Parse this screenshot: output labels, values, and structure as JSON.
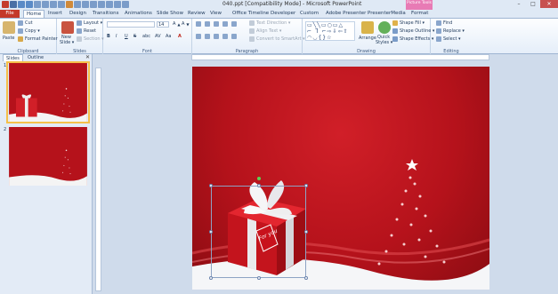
{
  "window": {
    "title": "040.ppt [Compatibility Mode] - Microsoft PowerPoint",
    "contextual_tab_group": "Picture Tools",
    "controls": [
      "–",
      "□",
      "✕"
    ]
  },
  "tabs": [
    "File",
    "Home",
    "Insert",
    "Design",
    "Transitions",
    "Animations",
    "Slide Show",
    "Review",
    "View",
    "Office Timeline",
    "Developer",
    "Custom",
    "Adobe Presenter",
    "PresenterMedia",
    "Format"
  ],
  "ribbon": {
    "clipboard": {
      "label": "Clipboard",
      "paste": "Paste",
      "cut": "Cut",
      "copy": "Copy ▾",
      "format_painter": "Format Painter"
    },
    "slides": {
      "label": "Slides",
      "new_slide": "New",
      "new_slide2": "Slide ▾",
      "layout": "Layout ▾",
      "reset": "Reset",
      "section": "Section ▾"
    },
    "font": {
      "label": "Font",
      "size": "14",
      "bold": "B",
      "italic": "I",
      "underline": "U",
      "strike": "S",
      "shadow": "abc",
      "spacing": "AV",
      "case": "Aa",
      "color": "A"
    },
    "paragraph": {
      "label": "Paragraph",
      "text_direction": "Text Direction ▾",
      "align_text": "Align Text ▾",
      "convert_smartart": "Convert to SmartArt ▾"
    },
    "drawing": {
      "label": "Drawing",
      "arrange": "Arrange",
      "quick_styles": "Quick",
      "quick_styles2": "Styles ▾",
      "shape_fill": "Shape Fill ▾",
      "shape_outline": "Shape Outline ▾",
      "shape_effects": "Shape Effects ▾"
    },
    "editing": {
      "label": "Editing",
      "find": "Find",
      "replace": "Replace ▾",
      "select": "Select ▾"
    }
  },
  "left_pane": {
    "tabs": [
      "Slides",
      "Outline"
    ],
    "close": "✕",
    "slide_numbers": [
      "1",
      "2"
    ]
  },
  "slide": {
    "gift_tag": "For you",
    "background_color": "#b5121b"
  },
  "colors": {
    "file_tab": "#c4392a",
    "picture_tools": "#e87bb5",
    "selection_outline": "#f5c04a"
  }
}
